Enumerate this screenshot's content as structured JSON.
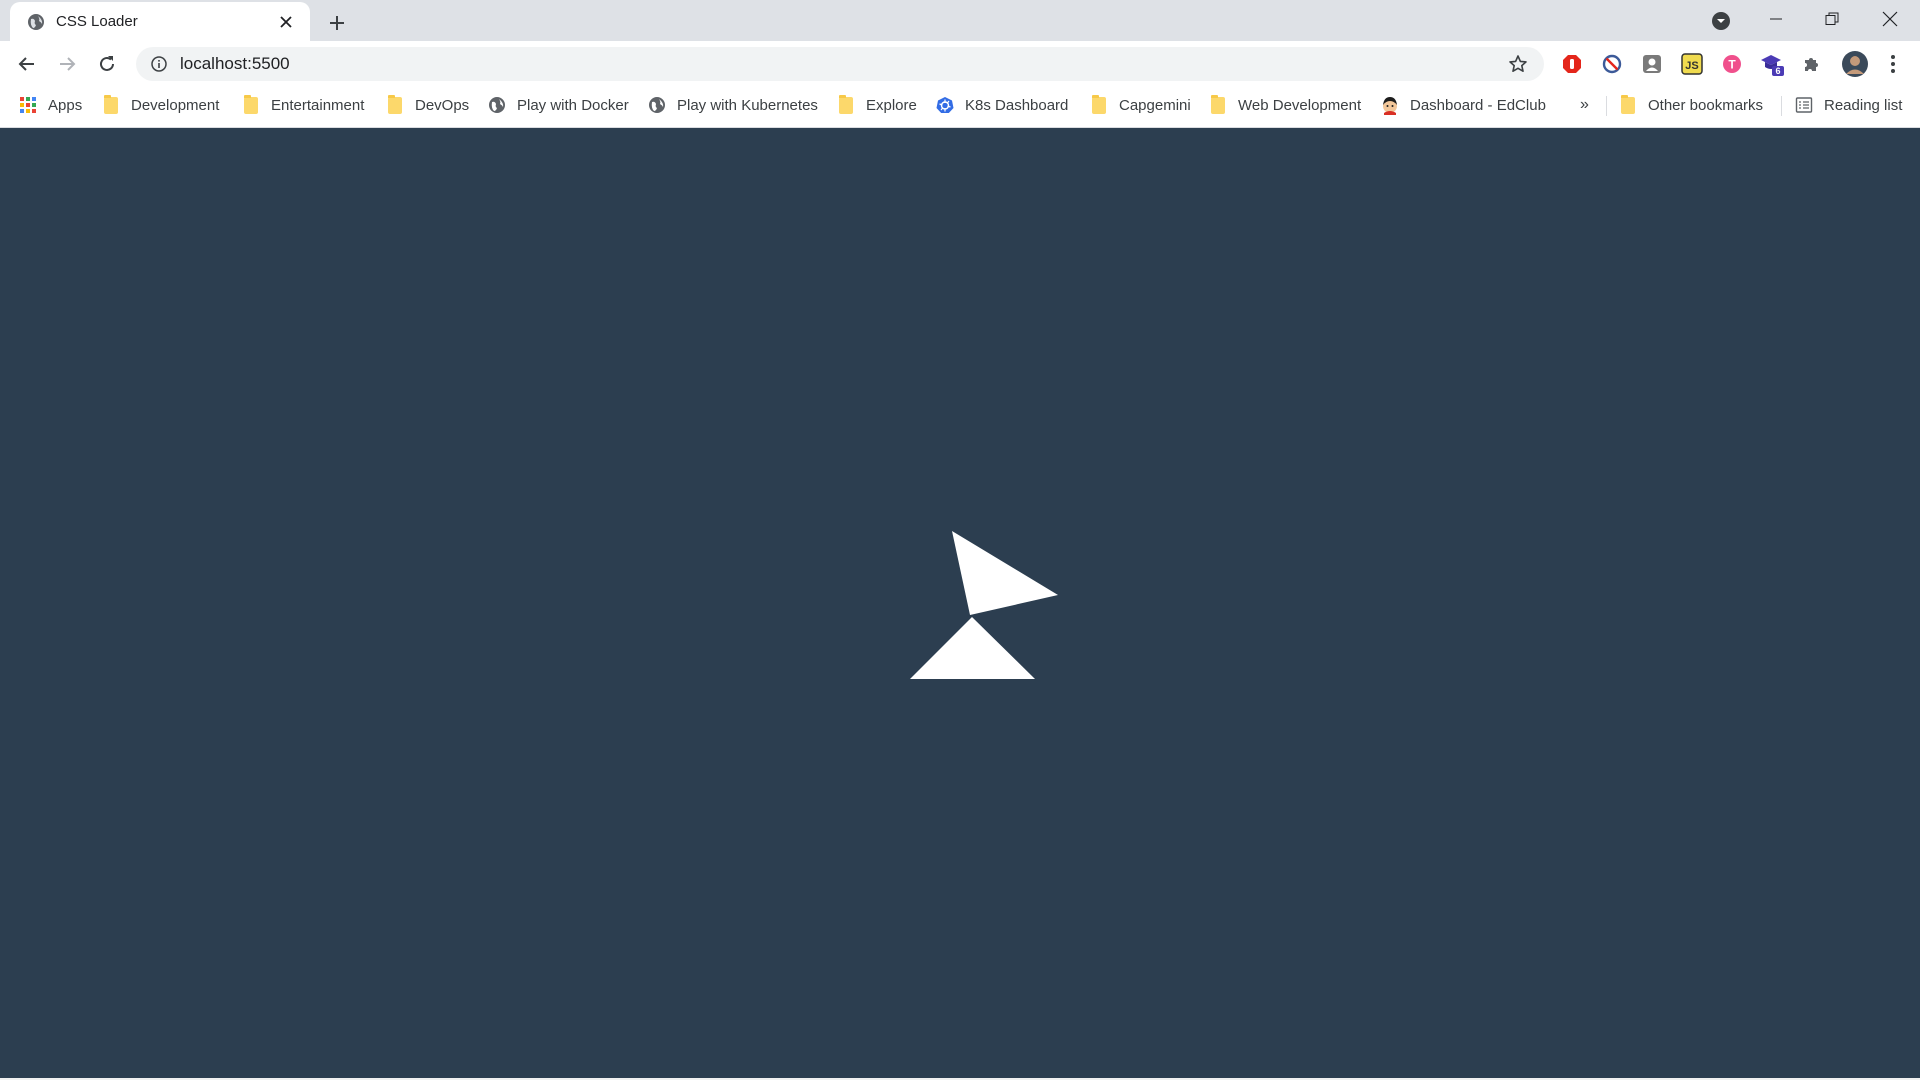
{
  "browser": {
    "tab": {
      "title": "CSS Loader",
      "favicon": "globe-icon"
    },
    "new_tab_icon": "plus-icon",
    "tab_search_icon": "chevron-down-circle-icon",
    "window_controls": [
      "minimize-icon",
      "restore-icon",
      "close-icon"
    ],
    "address": "localhost:5500",
    "extensions": [
      {
        "name": "adblock-icon",
        "color": "#e4261b"
      },
      {
        "name": "block-icon",
        "color": "#3c5a99"
      },
      {
        "name": "portrait-extension-icon",
        "color": "#7a7a7a"
      },
      {
        "name": "js-extension-icon",
        "label": "JS",
        "color": "#f0db4f"
      },
      {
        "name": "t-extension-icon",
        "label": "T",
        "color": "#f0508c"
      },
      {
        "name": "graduation-cap-icon",
        "badge": "6",
        "color": "#4b3bb5"
      },
      {
        "name": "puzzle-icon",
        "color": "#5f6368"
      }
    ],
    "bookmarks": [
      {
        "label": "Apps",
        "icon": "apps-grid-icon"
      },
      {
        "label": "Development",
        "icon": "folder-icon"
      },
      {
        "label": "Entertainment",
        "icon": "folder-icon"
      },
      {
        "label": "DevOps",
        "icon": "folder-icon"
      },
      {
        "label": "Play with Docker",
        "icon": "globe-icon"
      },
      {
        "label": "Play with Kubernetes",
        "icon": "globe-icon"
      },
      {
        "label": "Explore",
        "icon": "folder-icon"
      },
      {
        "label": "K8s Dashboard",
        "icon": "kubernetes-icon"
      },
      {
        "label": "Capgemini",
        "icon": "folder-icon"
      },
      {
        "label": "Web Development",
        "icon": "folder-icon"
      },
      {
        "label": "Dashboard - EdClub",
        "icon": "edclub-icon"
      }
    ],
    "overflow_chevron": "»",
    "other_bookmarks": "Other bookmarks",
    "reading_list": "Reading list"
  },
  "page": {
    "background": "#2c3e50",
    "loader_color": "#ffffff"
  }
}
